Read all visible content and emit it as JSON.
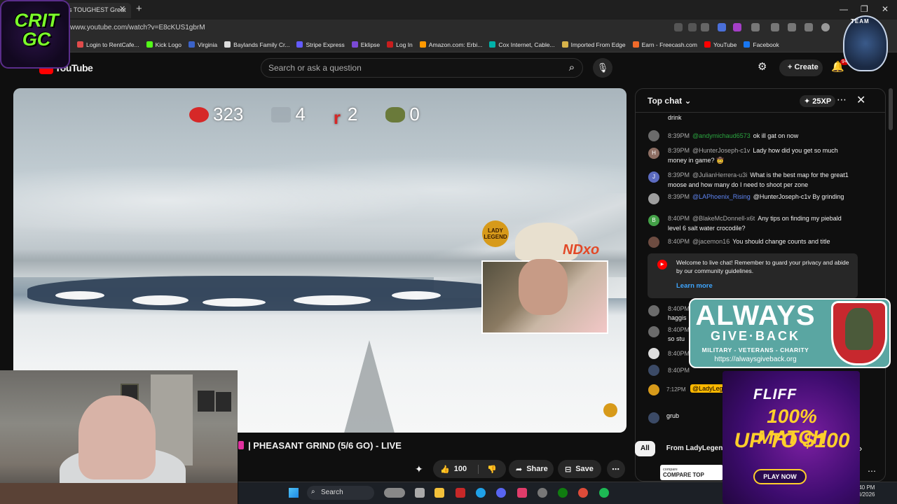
{
  "browser": {
    "tab_title": "s TOUGHEST Great",
    "url": "www.youtube.com/watch?v=E8cKUS1gbrM",
    "bookmarks": [
      "Login to RentCafe...",
      "Kick Logo",
      "Virginia",
      "Baylands Family Cr...",
      "Stripe Express",
      "Eklipse",
      "Log In",
      "Amazon.com: Erbi...",
      "Cox Internet, Cable...",
      "Imported From Edge",
      "Earn - Freecash.com",
      "YouTube",
      "Facebook"
    ]
  },
  "youtube": {
    "logo": "YouTube",
    "search_placeholder": "Search or ask a question",
    "create_label": "Create",
    "notif_count": "9+"
  },
  "video": {
    "hud": {
      "kills": "323",
      "shots": "4",
      "r_count": "2",
      "other": "0"
    },
    "overlay_logo": "LADY LEGEND",
    "overlay_suffix": "NDxo",
    "title": "| PHEASANT GRIND (5/6 GO) - LIVE",
    "like_count": "100",
    "share_label": "Share",
    "save_label": "Save"
  },
  "chat": {
    "header": "Top chat",
    "xp": "25XP",
    "partial_top": "drink",
    "messages": [
      {
        "time": "8:39PM",
        "user": "@andymichaud6573",
        "text": "ok ill gat on now",
        "av": "",
        "color": "g"
      },
      {
        "time": "8:39PM",
        "user": "@HunterJoseph-c1v",
        "text": "Lady how did you get so much money in game? 🤠",
        "av": "H",
        "color": ""
      },
      {
        "time": "8:39PM",
        "user": "@JulianHerrera-u3i",
        "text": "What is the best map for the great1 moose and how many do I need to shoot per zone",
        "av": "J",
        "color": ""
      },
      {
        "time": "8:39PM",
        "user": "@LAPhoenix_Rising",
        "text": "@HunterJoseph-c1v By grinding",
        "av": "",
        "color": "b"
      },
      {
        "time": "8:40PM",
        "user": "@BlakeMcDonnell-x6t",
        "text": "Any tips on finding my piebald level 6 salt water crocodile?",
        "av": "B",
        "color": ""
      },
      {
        "time": "8:40PM",
        "user": "@jacemon16",
        "text": "You should change counts and title",
        "av": "",
        "color": ""
      }
    ],
    "partial_msgs": [
      "8:40PM",
      "haggis",
      "8:40PM",
      "so stu",
      "8:40PM",
      "8:40PM"
    ],
    "welcome": "Welcome to live chat! Remember to guard your privacy and abide by our community guidelines.",
    "learn_more": "Learn more",
    "pinned_time": "7:12PM",
    "pinned_user": "@LadyLeg",
    "input_text": "grub",
    "chips": [
      "All",
      "From LadyLegend"
    ],
    "compare_ad": "COMPARE TOP",
    "compare_brand": "compare"
  },
  "overlays": {
    "crit_gc": "CRIT GC",
    "team": "TEAM",
    "agb_title": "ALWAYS",
    "agb_sub": "GIVE·BACK",
    "agb_tag": "MILITARY - VETERANS - CHARITY",
    "agb_url": "https://alwaysgiveback.org",
    "fliff_logo": "FLIFF",
    "fliff_line1": "100% MATCH",
    "fliff_line2": "UP TO $100",
    "fliff_btn": "PLAY NOW"
  },
  "taskbar": {
    "search": "Search",
    "time": "40 PM",
    "date": "3/2026"
  },
  "colors": {
    "yt_red": "#ff0000",
    "chat_green": "#2ba640",
    "link_blue": "#3ea6ff",
    "fliff_gold": "#ffcf2b",
    "agb_teal": "#5aa6a2"
  }
}
